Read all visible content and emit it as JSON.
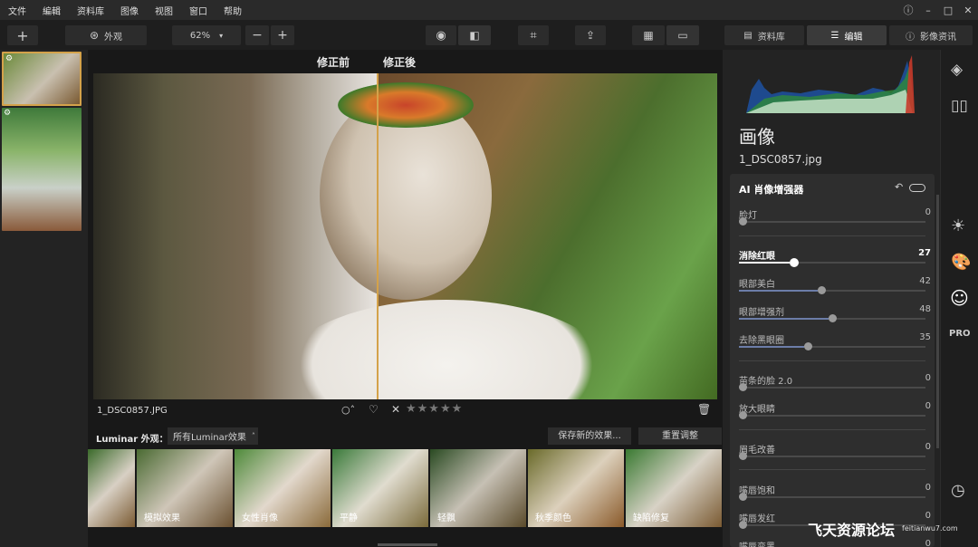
{
  "menu": [
    "文件",
    "編輯",
    "资料库",
    "图像",
    "视图",
    "窗口",
    "帮助"
  ],
  "toolbar": {
    "add_icon": "plus-icon",
    "look_label": "外观",
    "zoom": "62%",
    "library_tab": "资料库",
    "edit_tab": "编辑",
    "info_tab": "影像资讯"
  },
  "compare": {
    "before": "修正前",
    "after": "修正後"
  },
  "image_info": {
    "filename": "1_DSC0857.JPG",
    "rating": 0
  },
  "looks": {
    "label": "Luminar 外观：",
    "dropdown": "所有Luminar效果",
    "save_btn": "保存新的效果...",
    "reset_btn": "重置调整",
    "items": [
      "",
      "模拟效果",
      "女性肖像",
      "平静",
      "轻飘",
      "秋季颜色",
      "缺陷修复"
    ]
  },
  "panel": {
    "title": "画像",
    "filename": "1_DSC0857.jpg",
    "module": "AI 肖像增强器",
    "sliders": [
      {
        "name": "脸灯",
        "value": "0",
        "pos": 0
      },
      {
        "name": "消除红眼",
        "value": "27",
        "pos": 27
      },
      {
        "name": "眼部美白",
        "value": "42",
        "pos": 42
      },
      {
        "name": "眼部增强剂",
        "value": "48",
        "pos": 48
      },
      {
        "name": "去除黑眼圈",
        "value": "35",
        "pos": 35
      },
      {
        "name": "苗条的脸 2.0",
        "value": "0",
        "pos": 0
      },
      {
        "name": "放大眼睛",
        "value": "0",
        "pos": 0
      },
      {
        "name": "眉毛改善",
        "value": "0",
        "pos": 0
      },
      {
        "name": "嘴唇饱和",
        "value": "0",
        "pos": 0
      },
      {
        "name": "嘴唇发红",
        "value": "0",
        "pos": 0
      },
      {
        "name": "嘴唇变黑",
        "value": "0",
        "pos": 0
      }
    ]
  },
  "watermark": {
    "text": "飞天资源论坛",
    "url": "feitianwu7.com"
  },
  "colors": {
    "accent": "#d4a24a",
    "slider_fill": "#6c7da8"
  }
}
